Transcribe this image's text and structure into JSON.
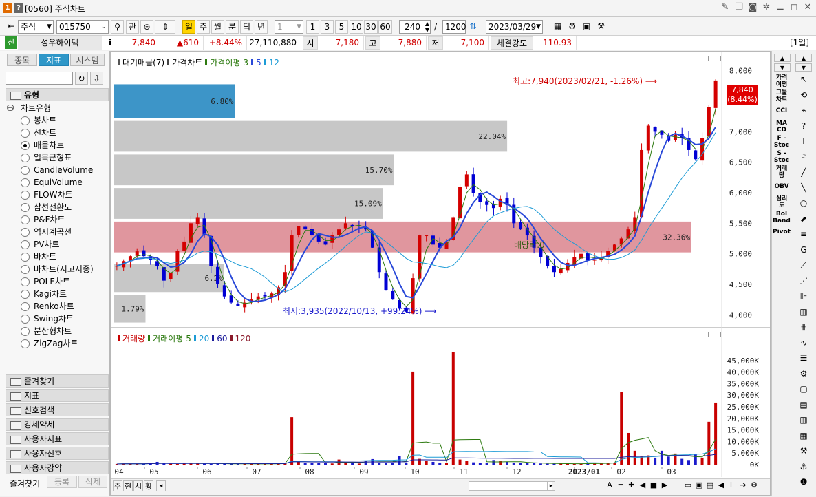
{
  "window": {
    "title_code": "[0560]",
    "title": "주식차트",
    "badge1": "1",
    "badge2": "?",
    "controls": [
      "⚊",
      "◻",
      "✕"
    ]
  },
  "toolbar": {
    "market": "주식",
    "code": "015750",
    "btn_gwan": "관",
    "periods": [
      "일",
      "주",
      "월",
      "분",
      "틱",
      "년"
    ],
    "active_period": "일",
    "tick_select": "1",
    "intervals": [
      "1",
      "3",
      "5",
      "10",
      "30",
      "60"
    ],
    "count": "240",
    "slash": "/",
    "total": "1200",
    "date": "2023/03/29"
  },
  "infobar": {
    "badge": "신",
    "name": "성우하이텍",
    "info_icon": "i",
    "price": "7,840",
    "change": "▲610",
    "change_rate": "+8.44%",
    "volume": "27,110,880",
    "open_label": "시",
    "open": "7,180",
    "high_label": "고",
    "high": "7,880",
    "low_label": "저",
    "low": "7,100",
    "strength_label": "체결강도",
    "strength": "110.93",
    "period_tag": "[1일]"
  },
  "left": {
    "tabs": [
      "종목",
      "지표",
      "시스템"
    ],
    "active_tab": "지표",
    "section_type": "유형",
    "tree_root": "차트유형",
    "chart_types": [
      "봉차트",
      "선차트",
      "매물차트",
      "일목균형표",
      "CandleVolume",
      "EquiVolume",
      "FLOW차트",
      "삼선전환도",
      "P&F차트",
      "역시계곡선",
      "PV차트",
      "바차트",
      "바차트(시고저종)",
      "POLE차트",
      "Kagi차트",
      "Renko차트",
      "Swing차트",
      "분산형차트",
      "ZigZag차트"
    ],
    "selected_type": "매물차트",
    "sections": [
      "즐겨찾기",
      "지표",
      "신호검색",
      "강세약세",
      "사용자지표",
      "사용자신호",
      "사용자강약"
    ],
    "bottom_tabs": [
      "즐겨찾기",
      "등록",
      "삭제"
    ]
  },
  "chart": {
    "price_legend": [
      "대기매물(7)",
      "가격차트",
      "가격이평",
      "3",
      "5",
      "12"
    ],
    "volume_legend": [
      "거래량",
      "거래이평",
      "5",
      "20",
      "60",
      "120"
    ],
    "price_ticks": [
      "8,000",
      "7,500",
      "7,000",
      "6,500",
      "6,000",
      "5,500",
      "5,000",
      "4,500",
      "4,000"
    ],
    "volume_ticks": [
      "45,000K",
      "40,000K",
      "35,000K",
      "30,000K",
      "25,000K",
      "20,000K",
      "15,000K",
      "10,000K",
      "5,000K",
      "0K"
    ],
    "x_ticks": [
      "04",
      "05",
      "06",
      "07",
      "08",
      "09",
      "10",
      "11",
      "12",
      "2023/01",
      "02",
      "03"
    ],
    "high_note": "최고:7,940(2023/02/21, -1.26%)",
    "low_note": "최저:3,935(2022/10/13, +99.24%)",
    "dividend_note": "배당락:0",
    "last_price_tag": "7,840",
    "last_rate_tag": "(8.44%)",
    "bottom_tabs": [
      "주",
      "현",
      "시",
      "황"
    ],
    "colors": {
      "candle_up": "#d40000",
      "candle_down": "#0000d4",
      "ma3": "#2d7a10",
      "ma5": "#2848d8",
      "ma12": "#1c9bd6",
      "vol": "#c80000",
      "profile": "#c7c7c7",
      "profile_max": "#e0969e",
      "profile_cur": "#3d95c8"
    }
  },
  "chart_data": {
    "type": "bar",
    "title": "대기매물(7)",
    "price_range": [
      3800,
      8200
    ],
    "bins": [
      {
        "label": "1.79%",
        "value": 1.79,
        "range": [
          3850,
          4350
        ]
      },
      {
        "label": "6.2%",
        "value": 6.2,
        "range": [
          4350,
          4850
        ]
      },
      {
        "label": "32.36%",
        "value": 32.36,
        "range": [
          5000,
          5550
        ]
      },
      {
        "label": "15.09%",
        "value": 15.09,
        "range": [
          5550,
          6100
        ]
      },
      {
        "label": "15.70%",
        "value": 15.7,
        "range": [
          6100,
          6650
        ]
      },
      {
        "label": "22.04%",
        "value": 22.04,
        "range": [
          6650,
          7200
        ]
      },
      {
        "label": "6.80%",
        "value": 6.8,
        "range": [
          7200,
          7800
        ]
      }
    ],
    "price_series": [
      4800,
      4880,
      4960,
      5040,
      4960,
      4900,
      4800,
      4560,
      4680,
      5050,
      5200,
      5500,
      5600,
      5300,
      4800,
      4500,
      4300,
      4200,
      4150,
      4200,
      4250,
      4300,
      4300,
      4350,
      4450,
      4700,
      5300,
      5450,
      5400,
      5300,
      5200,
      5150,
      5300,
      5400,
      5500,
      5450,
      5450,
      5400,
      5100,
      4700,
      4400,
      4250,
      4100,
      4050,
      4600,
      5300,
      5300,
      5150,
      5100,
      5200,
      5600,
      6100,
      6300,
      6000,
      5850,
      5800,
      5750,
      5900,
      5800,
      5500,
      5400,
      5300,
      5100,
      4950,
      4800,
      4700,
      4750,
      4850,
      4950,
      5000,
      4900,
      4900,
      4950,
      5050,
      5150,
      5250,
      5400,
      5600,
      6700,
      7100,
      7000,
      6950,
      6850,
      6950,
      6900,
      6700,
      6550,
      6900,
      7400,
      7840
    ],
    "volume_series": [
      300,
      500,
      400,
      350,
      300,
      800,
      1200,
      600,
      400,
      300,
      900,
      700,
      500,
      400,
      300,
      600,
      400,
      300,
      350,
      300,
      400,
      350,
      300,
      400,
      500,
      800,
      20500,
      1200,
      900,
      800,
      700,
      600,
      500,
      2200,
      700,
      600,
      500,
      1800,
      2400,
      900,
      800,
      700,
      3800,
      900,
      40200,
      2500,
      1500,
      1200,
      900,
      800,
      48800,
      2200,
      1500,
      1000,
      800,
      700,
      2000,
      1500,
      1200,
      900,
      800,
      700,
      600,
      500,
      400,
      400,
      500,
      400,
      450,
      400,
      500,
      600,
      700,
      800,
      900,
      31300,
      13700,
      6000,
      3500,
      4000,
      3000,
      6000,
      3500,
      4800,
      2500,
      2000,
      4500,
      3000,
      18500,
      26800
    ],
    "ylim_volume": [
      0,
      50000
    ]
  }
}
